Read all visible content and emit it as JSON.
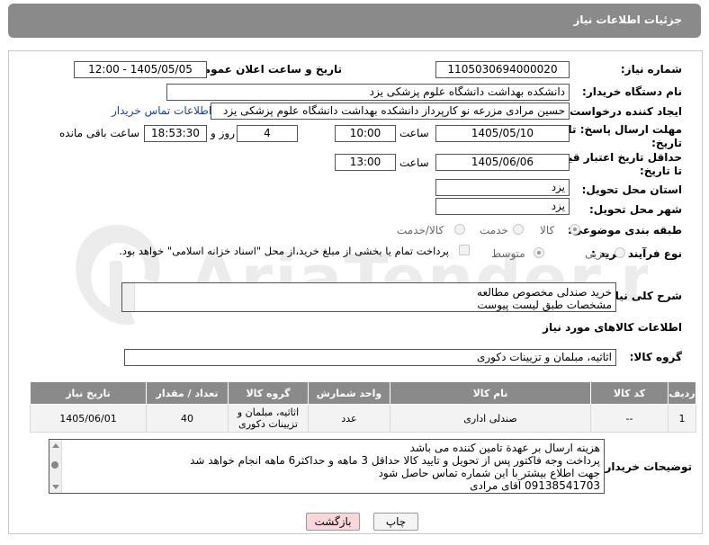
{
  "header": {
    "title": "جزئیات اطلاعات نیاز"
  },
  "fields": {
    "need_number_label": "شماره نیاز:",
    "need_number": "1105030694000020",
    "announce_label": "تاریخ و ساعت اعلان عمومی:",
    "announce_value": "1405/05/05 - 12:00",
    "buyer_org_label": "نام دستگاه خریدار:",
    "buyer_org": "دانشکده بهداشت دانشگاه علوم پزشکی یزد",
    "creator_label": "ایجاد کننده درخواست:",
    "creator": "حسین مرادی مزرعه نو کارپرداز دانشکده بهداشت دانشگاه علوم پزشکی یزد",
    "contact_link": "اطلاعات تماس خریدار",
    "deadline_label_1": "مهلت ارسال پاسخ: تا",
    "deadline_label_2": "تاریخ:",
    "deadline_date": "1405/05/10",
    "time_label": "ساعت",
    "deadline_time": "10:00",
    "days": "4",
    "days_label": "روز و",
    "remaining": "18:53:30",
    "remaining_label": "ساعت باقی مانده",
    "price_label_1": "حداقل تاریخ اعتبار قیمت:",
    "price_label_2": "تا تاریخ:",
    "price_date": "1405/06/06",
    "price_time": "13:00",
    "province_label": "استان محل تحویل:",
    "province": "یزد",
    "city_label": "شهر محل تحویل:",
    "city": "یزد",
    "category_label": "طبقه بندی موضوعی:",
    "category_options": [
      "کالا",
      "خدمت",
      "کالا/خدمت"
    ],
    "process_label": "نوع فرآیند خرید :",
    "process_options": [
      "جزیی",
      "متوسط"
    ],
    "payment_note": "پرداخت تمام یا بخشی از مبلغ خرید،از محل \"اسناد خزانه اسلامی\" خواهد بود."
  },
  "summary": {
    "label": "شرح کلی نیاز:",
    "line1": "خرید صندلی مخصوص مطالعه",
    "line2": "مشخصات طبق لیست پیوست"
  },
  "goods": {
    "section_title": "اطلاعات کالاهای مورد نیاز",
    "group_label": "گروه کالا:",
    "group_value": "اثاثیه، مبلمان و تزیینات دکوری",
    "columns": [
      "ردیف",
      "کد کالا",
      "نام کالا",
      "واحد شمارش",
      "گروه کالا",
      "تعداد / مقدار",
      "تاریخ نیاز"
    ],
    "rows": [
      {
        "row": "1",
        "code": "--",
        "name": "صندلی اداری",
        "unit": "عدد",
        "group_line1": "اثاثیه، مبلمان و",
        "group_line2": "تزیینات دکوری",
        "qty": "40",
        "date": "1405/06/01"
      }
    ]
  },
  "buyer_notes": {
    "label": "توضیحات خریدار:",
    "lines": [
      "هزینه ارسال بر عهدة تامین کننده می باشد",
      "پرداخت وجه فاکتور پس از تحویل و تایید کالا حداقل 3 ماهه و حداکثر6 ماهه انجام خواهد شد",
      "جهت اطلاع بیشتر با این شماره تماس حاصل شود",
      "09138541703 آقای مرادی"
    ]
  },
  "buttons": {
    "print": "چاپ",
    "back": "بازگشت"
  },
  "watermark": {
    "text": "AriaTender.net"
  },
  "colors": {
    "header_bg": "#8a8a8a",
    "link": "#1a3fb0",
    "back_button_bg": "#f8d7da"
  }
}
